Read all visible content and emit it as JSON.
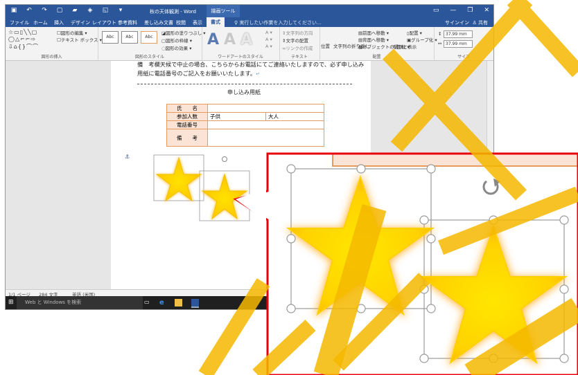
{
  "title_bar": {
    "doc_title": "秋の天体観測 - Word",
    "contextual_tab": "描画ツール",
    "quick_access": [
      "保存",
      "元に戻す",
      "やり直し",
      "新規",
      "開く",
      "PDF",
      "印刷プレビュー",
      "ユーザー設定"
    ]
  },
  "tabs": {
    "items": [
      "ファイル",
      "ホーム",
      "挿入",
      "デザイン",
      "レイアウト",
      "参考資料",
      "差し込み文書",
      "校閲",
      "表示"
    ],
    "active": "書式",
    "search_placeholder": "実行したい作業を入力してください...",
    "signin": "サインイン",
    "share": "共有"
  },
  "ribbon": {
    "insert_shapes": {
      "label": "図形の挿入",
      "edit_shape": "図形の編集",
      "text_box": "テキスト ボックス"
    },
    "shape_styles": {
      "label": "図形のスタイル",
      "fill": "図形の塗りつぶし",
      "outline": "図形の枠線",
      "effects": "図形の効果",
      "style_box": "Abc"
    },
    "wordart": {
      "label": "ワードアートのスタイル",
      "letter": "A"
    },
    "text": {
      "label": "テキスト",
      "direction": "文字列の方向",
      "align": "文字の配置",
      "link": "リンクの作成"
    },
    "arrange": {
      "label": "配置",
      "position": "位置",
      "wrap": "文字列の折り返し",
      "forward": "前面へ移動",
      "backward": "背面へ移動",
      "selection_pane": "オブジェクトの選択と表示",
      "align": "配置",
      "group": "グループ化",
      "rotate": "回転"
    },
    "size": {
      "label": "サイズ",
      "height": "37.99 mm",
      "width": "37.99 mm"
    }
  },
  "document": {
    "line1": "備　考欄天候で中止の場合、こちらからお電話にてご連絡いたしますので、必ず申し込み",
    "line2": "用紙に電話番号のご記入をお願いいたします。",
    "form_title": "申し込み用紙",
    "return_mark": "↵",
    "form": {
      "row1_label": "氏　　名",
      "row2_label": "参加人数",
      "row2_child": "子供",
      "row2_adult": "大人",
      "row3_label": "電話番号",
      "row4_label": "備　　考"
    }
  },
  "status_bar": {
    "page": "1/1 ページ",
    "words": "284 文字",
    "language": "英語 (米国)"
  },
  "taskbar": {
    "search": "Web と Windows を検索"
  },
  "colors": {
    "word_blue": "#2b579a",
    "table_border": "#e89b5e",
    "table_fill": "#fbe4d5",
    "callout_red": "#e8000b",
    "star_yellow": "#ffe600",
    "overlay_orange": "#f5b800"
  }
}
